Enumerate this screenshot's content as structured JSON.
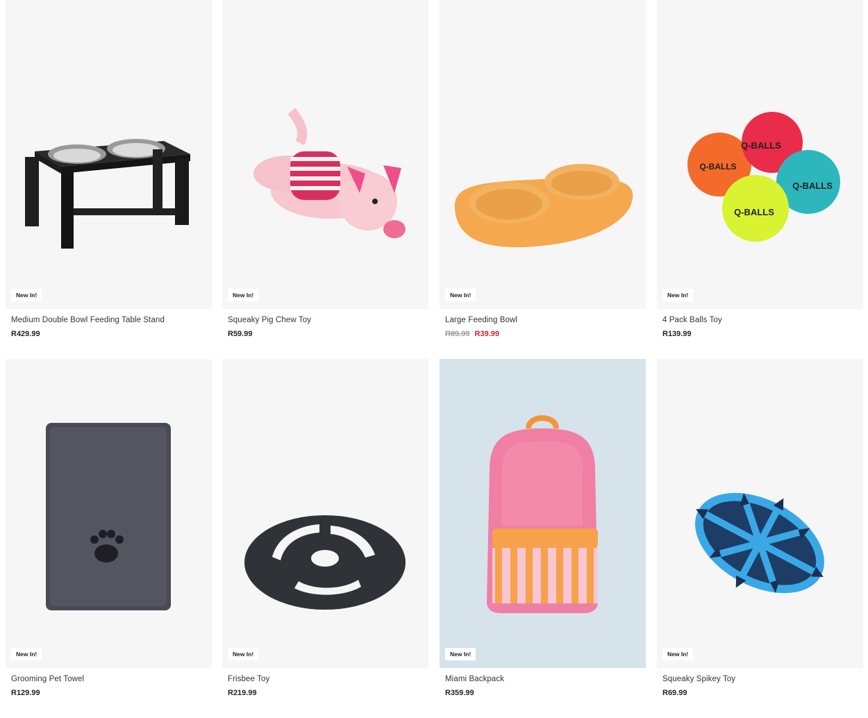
{
  "products": [
    {
      "name": "Medium Double Bowl Feeding Table Stand",
      "badge": "New In!",
      "price": "R429.99",
      "old_price": "",
      "sale_price": ""
    },
    {
      "name": "Squeaky Pig Chew Toy",
      "badge": "New In!",
      "price": "R59.99",
      "old_price": "",
      "sale_price": ""
    },
    {
      "name": "Large Feeding Bowl",
      "badge": "New In!",
      "price": "",
      "old_price": "R89.99",
      "sale_price": "R39.99"
    },
    {
      "name": "4 Pack Balls Toy",
      "badge": "New In!",
      "price": "R139.99",
      "old_price": "",
      "sale_price": "",
      "ball_label": "Q-BALLS"
    },
    {
      "name": "Grooming Pet Towel",
      "badge": "New In!",
      "price": "R129.99",
      "old_price": "",
      "sale_price": ""
    },
    {
      "name": "Frisbee Toy",
      "badge": "New In!",
      "price": "R219.99",
      "old_price": "",
      "sale_price": ""
    },
    {
      "name": "Miami Backpack",
      "badge": "New In!",
      "price": "R359.99",
      "old_price": "",
      "sale_price": ""
    },
    {
      "name": "Squeaky Spikey Toy",
      "badge": "New In!",
      "price": "R69.99",
      "old_price": "",
      "sale_price": ""
    }
  ],
  "colors": {
    "sale": "#c4262e",
    "image_bg": "#f6f6f6",
    "backpack_bg": "#d6e3ea"
  }
}
